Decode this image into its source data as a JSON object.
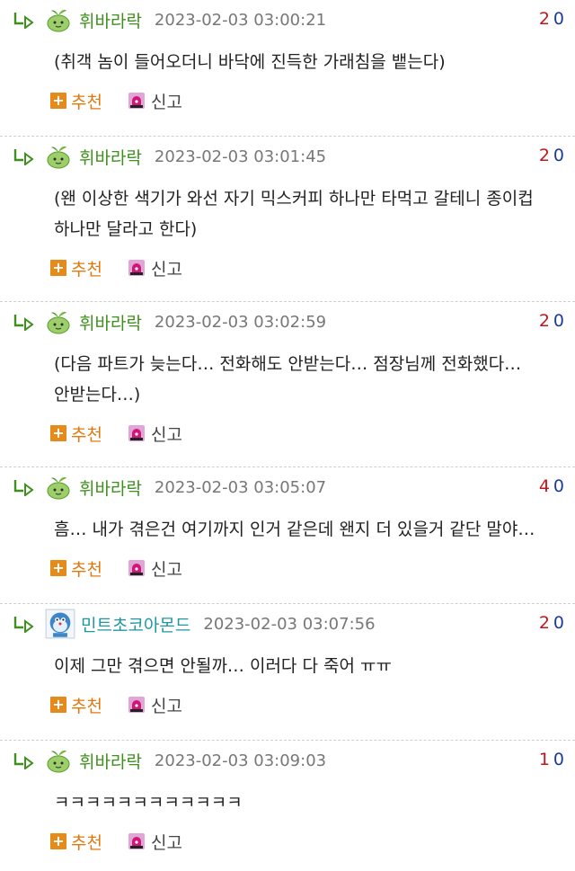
{
  "actions": {
    "recommend_label": "추천",
    "report_label": "신고",
    "recommend_symbol": "+"
  },
  "comments": [
    {
      "user": "휘바라락",
      "timestamp": "2023-02-03 03:00:21",
      "up": "2",
      "down": "0",
      "text": "(취객 놈이 들어오더니 바닥에 진득한 가래침을 뱉는다)"
    },
    {
      "user": "휘바라락",
      "timestamp": "2023-02-03 03:01:45",
      "up": "2",
      "down": "0",
      "text": "(왠 이상한 색기가 와선 자기 믹스커피 하나만 타먹고 갈테니 종이컵 하나만 달라고 한다)"
    },
    {
      "user": "휘바라락",
      "timestamp": "2023-02-03 03:02:59",
      "up": "2",
      "down": "0",
      "text": "(다음 파트가 늦는다… 전화해도 안받는다… 점장님께 전화했다… 안받는다…)"
    },
    {
      "user": "휘바라락",
      "timestamp": "2023-02-03 03:05:07",
      "up": "4",
      "down": "0",
      "text": "흠… 내가 겪은건 여기까지 인거 같은데 왠지 더 있을거 같단 말야…"
    },
    {
      "user": "민트초코아몬드",
      "timestamp": "2023-02-03 03:07:56",
      "up": "2",
      "down": "0",
      "text": "이제 그만 겪으면 안될까… 이러다 다 죽어 ㅠㅠ"
    },
    {
      "user": "휘바라락",
      "timestamp": "2023-02-03 03:09:03",
      "up": "1",
      "down": "0",
      "text": "ㅋㅋㅋㅋㅋㅋㅋㅋㅋㅋㅋㅋ"
    }
  ],
  "colors": {
    "username": "#3f8f1d",
    "username_alt": "#1d98a3",
    "upvote": "#c0161d",
    "downvote": "#1e3a9c",
    "recommend": "#e58a1b"
  },
  "icons": {
    "reply": "reply-arrow-icon",
    "avatar_leaf": "green-leaf-mascot-icon",
    "avatar_robot": "blue-robot-avatar-icon",
    "report": "siren-icon"
  }
}
